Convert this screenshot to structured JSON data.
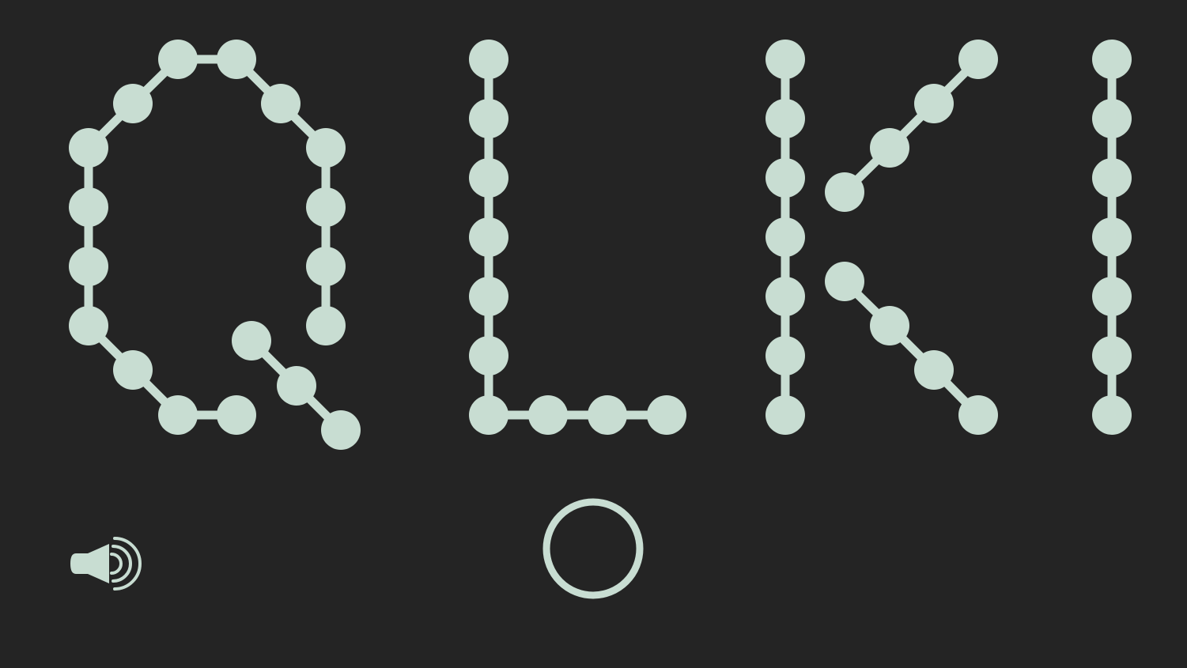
{
  "game": {
    "title": "QLKI",
    "letters": [
      "Q",
      "L",
      "K",
      "I"
    ]
  },
  "controls": {
    "sound_icon": "speaker-sound-on-icon",
    "action_button_icon": "circle-outline-icon"
  },
  "colors": {
    "background": "#242424",
    "bead": "#c8ddd2"
  }
}
